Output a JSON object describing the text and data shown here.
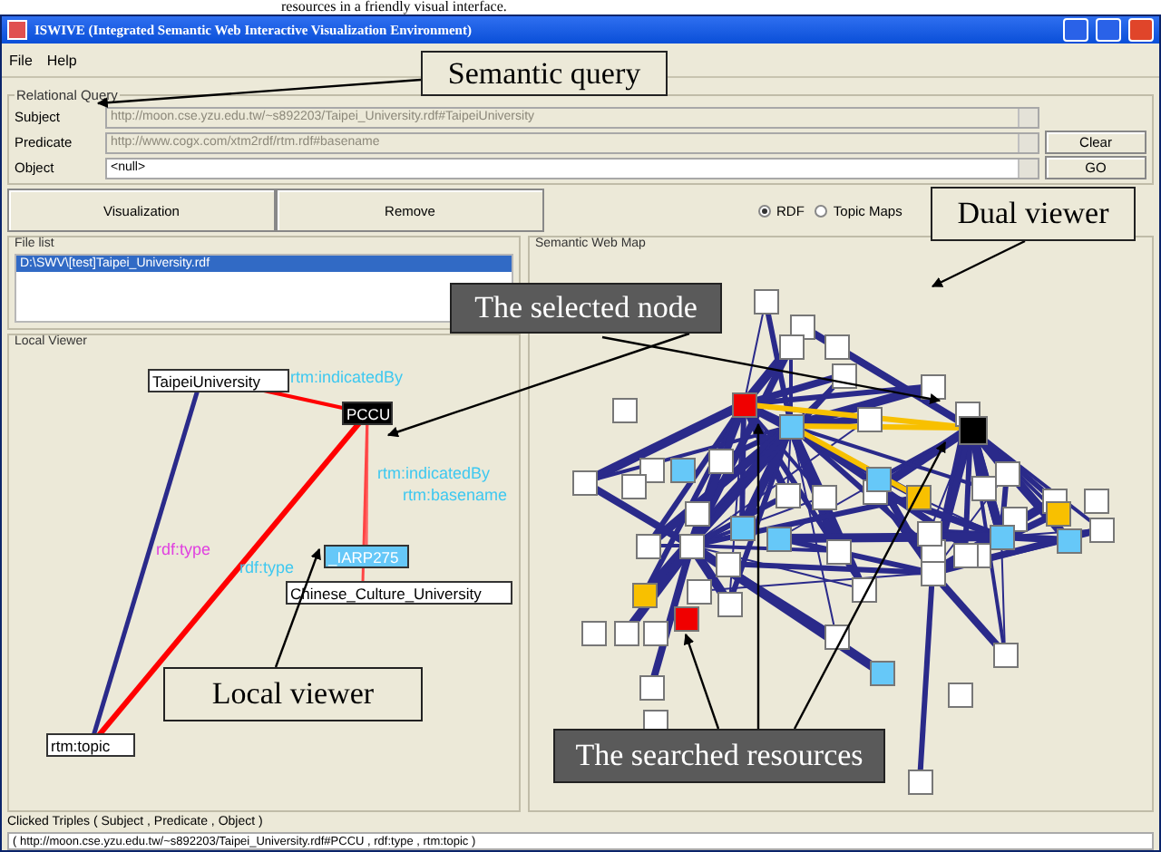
{
  "caption": "resources in a friendly visual interface.",
  "window": {
    "title": "ISWIVE (Integrated Semantic Web Interactive Visualization Environment)"
  },
  "menu": [
    "File",
    "Help"
  ],
  "query": {
    "title": "Relational Query",
    "fields": [
      {
        "label": "Subject",
        "value": "http://moon.cse.yzu.edu.tw/~s892203/Taipei_University.rdf#TaipeiUniversity",
        "disabled": true
      },
      {
        "label": "Predicate",
        "value": "http://www.cogx.com/xtm2rdf/rtm.rdf#basename",
        "disabled": true
      },
      {
        "label": "Object",
        "value": "<null>",
        "disabled": false
      }
    ],
    "buttons": [
      "Clear",
      "GO"
    ]
  },
  "actions": [
    "Visualization",
    "Remove"
  ],
  "modes": [
    {
      "label": "RDF",
      "selected": true
    },
    {
      "label": "Topic Maps",
      "selected": false
    }
  ],
  "file_list": {
    "title": "File list",
    "items": [
      {
        "label": "D:\\SWV\\[test]Taipei_University.rdf",
        "selected": true
      }
    ]
  },
  "local_viewer": {
    "title": "Local Viewer",
    "nodes": [
      {
        "label": "TaipeiUniversity",
        "kind": "plain"
      },
      {
        "label": "PCCU",
        "kind": "selected"
      },
      {
        "label": "_IARP275",
        "kind": "literal"
      },
      {
        "label": "Chinese_Culture_University",
        "kind": "plain"
      },
      {
        "label": "rtm:topic",
        "kind": "plain"
      }
    ],
    "edge_labels": [
      {
        "text": "rtm:indicatedBy",
        "color": "#3ec8f0"
      },
      {
        "text": "rtm:indicatedBy",
        "color": "#3ec8f0"
      },
      {
        "text": "rtm:basename",
        "color": "#3ec8f0"
      },
      {
        "text": "rdf:type",
        "color": "#e040e0"
      },
      {
        "text": "rdf:type",
        "color": "#3ec8f0"
      }
    ]
  },
  "map": {
    "title": "Semantic Web Map"
  },
  "clicked": {
    "label": "Clicked Triples ( Subject , Predicate , Object )",
    "value": "( http://moon.cse.yzu.edu.tw/~s892203/Taipei_University.rdf#PCCU , rdf:type , rtm:topic )"
  },
  "callouts": [
    {
      "text": "Semantic query",
      "kind": "light"
    },
    {
      "text": "Dual viewer",
      "kind": "light"
    },
    {
      "text": "The selected node",
      "kind": "dark"
    },
    {
      "text": "Local viewer",
      "kind": "light"
    },
    {
      "text": "The searched resources",
      "kind": "dark"
    }
  ]
}
